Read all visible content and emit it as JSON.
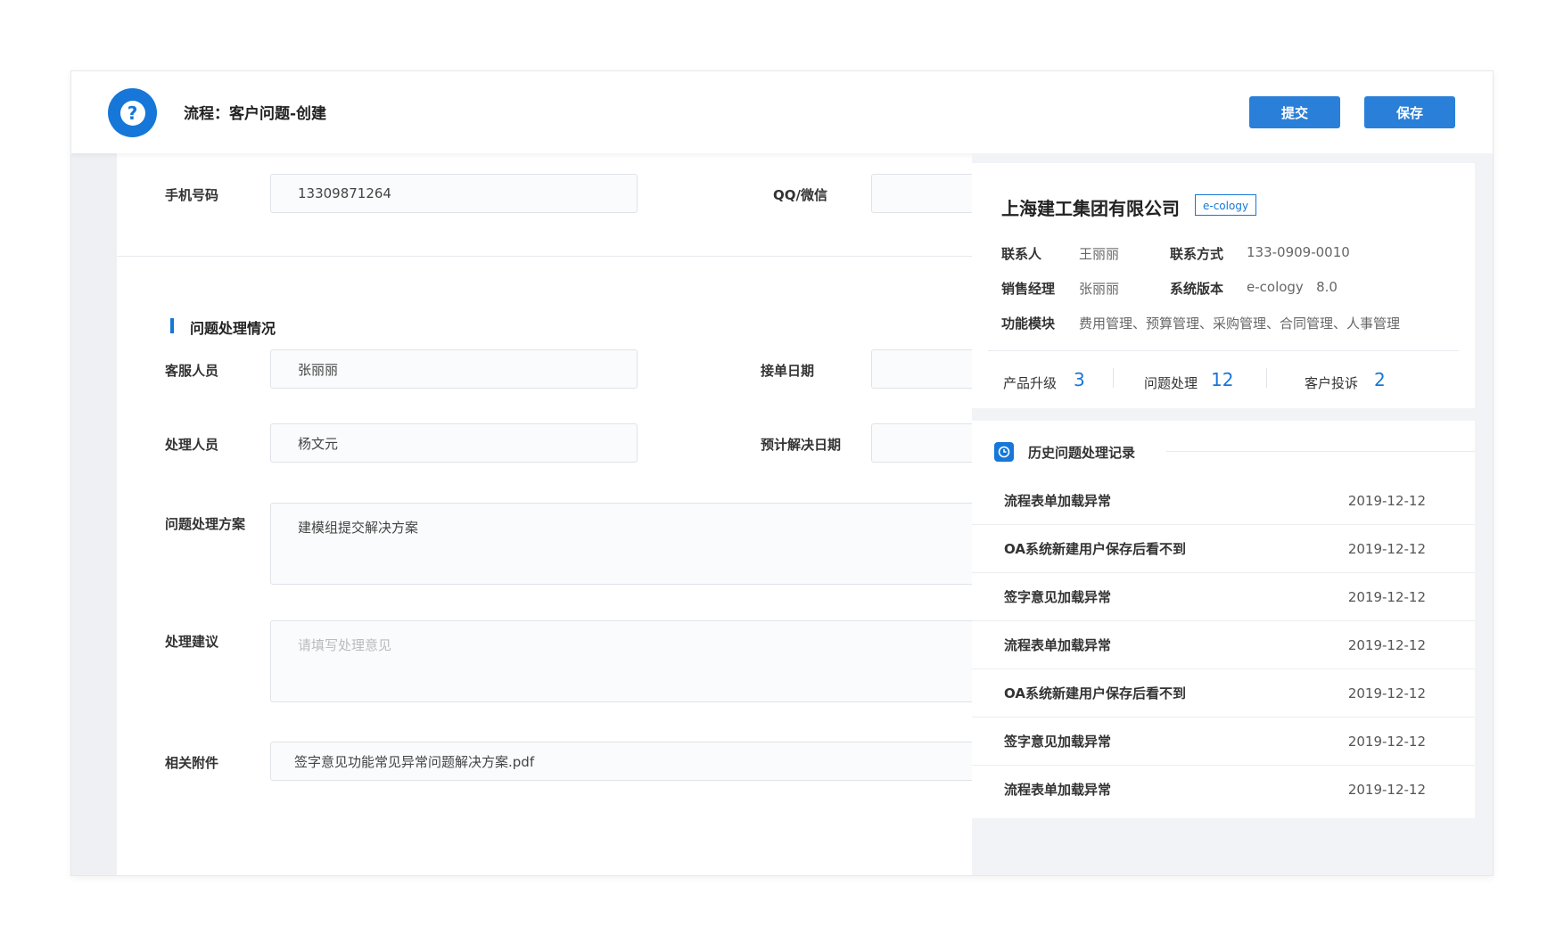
{
  "header": {
    "title": "流程：客户问题-创建",
    "logo_icon": "question-icon",
    "submit_label": "提交",
    "save_label": "保存"
  },
  "form": {
    "phone_label": "手机号码",
    "phone_value": "13309871264",
    "qq_label": "QQ/微信",
    "section_title": "问题处理情况",
    "service_label": "客服人员",
    "service_value": "张丽丽",
    "accept_date_label": "接单日期",
    "handler_label": "处理人员",
    "handler_value": "杨文元",
    "expected_date_label": "预计解决日期",
    "plan_label": "问题处理方案",
    "plan_value": "建模组提交解决方案",
    "advice_label": "处理建议",
    "advice_placeholder": "请填写处理意见",
    "attachment_label": "相关附件",
    "attachment_value": "签字意见功能常见异常问题解决方案.pdf"
  },
  "company": {
    "name": "上海建工集团有限公司",
    "tag": "e-cology",
    "contact_label": "联系人",
    "contact_value": "王丽丽",
    "phone_label": "联系方式",
    "phone_value": "133-0909-0010",
    "sales_label": "销售经理",
    "sales_value": "张丽丽",
    "version_label": "系统版本",
    "version_value": "e-cology   8.0",
    "modules_label": "功能模块",
    "modules_value": "费用管理、预算管理、采购管理、合同管理、人事管理",
    "stats": [
      {
        "label": "产品升级",
        "value": "3"
      },
      {
        "label": "问题处理",
        "value": "12"
      },
      {
        "label": "客户投诉",
        "value": "2"
      }
    ]
  },
  "history": {
    "title": "历史问题处理记录",
    "icon": "clock-icon",
    "items": [
      {
        "name": "流程表单加载异常",
        "date": "2019-12-12"
      },
      {
        "name": "OA系统新建用户保存后看不到",
        "date": "2019-12-12"
      },
      {
        "name": "签字意见加载异常",
        "date": "2019-12-12"
      },
      {
        "name": "流程表单加载异常",
        "date": "2019-12-12"
      },
      {
        "name": "OA系统新建用户保存后看不到",
        "date": "2019-12-12"
      },
      {
        "name": "签字意见加载异常",
        "date": "2019-12-12"
      },
      {
        "name": "流程表单加载异常",
        "date": "2019-12-12"
      }
    ]
  },
  "colors": {
    "accent": "#1677d9",
    "button": "#2a7fd8"
  }
}
